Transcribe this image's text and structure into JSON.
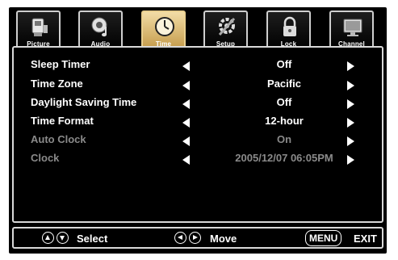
{
  "tabs": [
    {
      "label": "Picture",
      "icon": "picture-icon"
    },
    {
      "label": "Audio",
      "icon": "audio-icon"
    },
    {
      "label": "Time",
      "icon": "clock-icon",
      "active": true
    },
    {
      "label": "Setup",
      "icon": "setup-icon"
    },
    {
      "label": "Lock",
      "icon": "lock-icon"
    },
    {
      "label": "Channel",
      "icon": "channel-icon"
    }
  ],
  "settings": [
    {
      "label": "Sleep Timer",
      "value": "Off",
      "enabled": true
    },
    {
      "label": "Time Zone",
      "value": "Pacific",
      "enabled": true
    },
    {
      "label": "Daylight Saving Time",
      "value": "Off",
      "enabled": true
    },
    {
      "label": "Time Format",
      "value": "12-hour",
      "enabled": true
    },
    {
      "label": "Auto Clock",
      "value": "On",
      "enabled": false
    },
    {
      "label": "Clock",
      "value": "2005/12/07 06:05PM",
      "enabled": false
    }
  ],
  "help": {
    "select": "Select",
    "move": "Move",
    "menu_key": "MENU",
    "exit": "EXIT"
  },
  "colors": {
    "background": "#000000",
    "text": "#ffffff",
    "disabled_text": "#8a8a8a",
    "active_tab": "#d9b86a"
  }
}
